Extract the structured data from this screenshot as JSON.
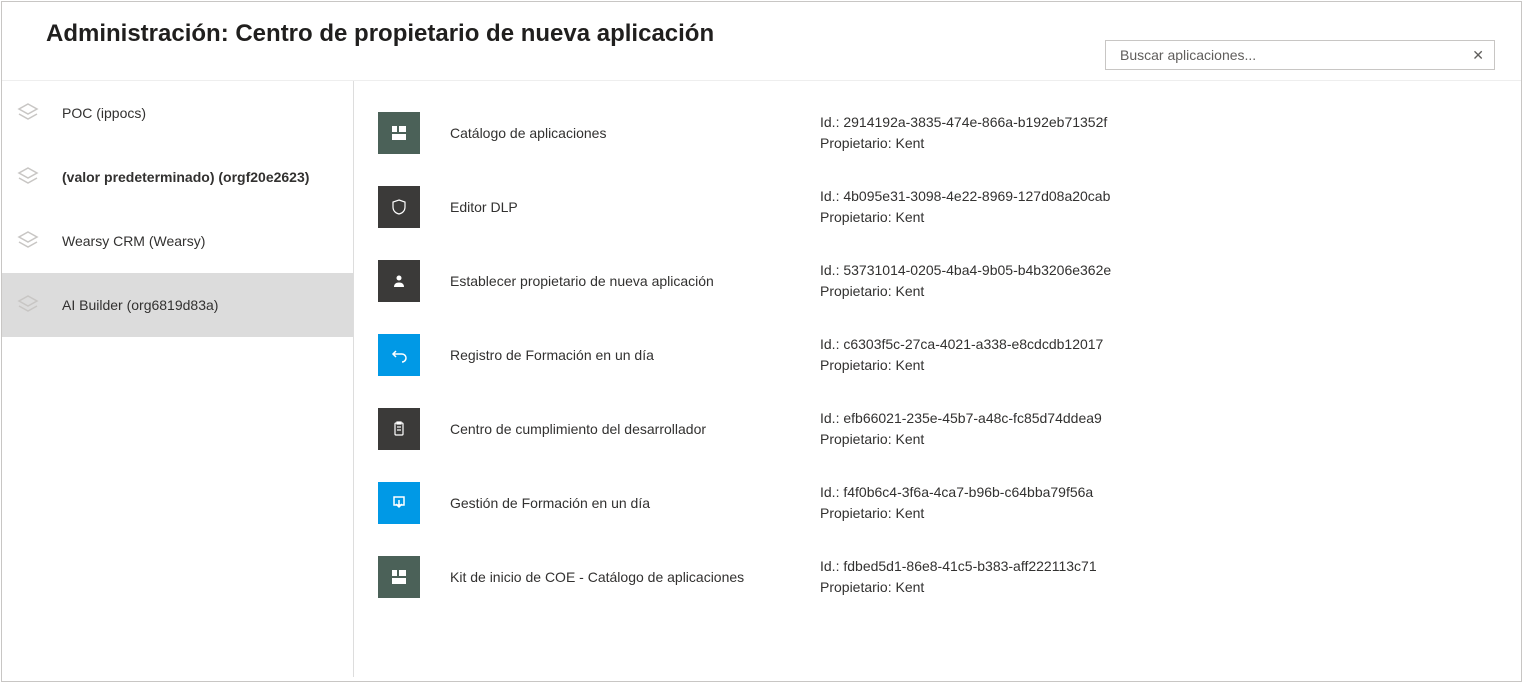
{
  "header": {
    "title": "Administración: Centro de propietario de nueva aplicación"
  },
  "search": {
    "placeholder": "Buscar aplicaciones..."
  },
  "id_label": "Id.:",
  "owner_label": "Propietario:",
  "sidebar": {
    "items": [
      {
        "label": "POC (ippocs)"
      },
      {
        "label": "(valor predeterminado) (orgf20e2623)"
      },
      {
        "label": "Wearsy CRM (Wearsy)"
      },
      {
        "label": "AI Builder (org6819d83a)"
      }
    ]
  },
  "apps": [
    {
      "name": "Catálogo de aplicaciones",
      "id": "2914192a-3835-474e-866a-b192eb71352f",
      "owner": "Kent"
    },
    {
      "name": "Editor DLP",
      "id": "4b095e31-3098-4e22-8969-127d08a20cab",
      "owner": "Kent"
    },
    {
      "name": "Establecer propietario de nueva aplicación",
      "id": "53731014-0205-4ba4-9b05-b4b3206e362e",
      "owner": "Kent"
    },
    {
      "name": "Registro de Formación en un día",
      "id": "c6303f5c-27ca-4021-a338-e8cdcdb12017",
      "owner": "Kent"
    },
    {
      "name": "Centro de cumplimiento del desarrollador",
      "id": "efb66021-235e-45b7-a48c-fc85d74ddea9",
      "owner": "Kent"
    },
    {
      "name": "Gestión de Formación en un día",
      "id": "f4f0b6c4-3f6a-4ca7-b96b-c64bba79f56a",
      "owner": "Kent"
    },
    {
      "name": "Kit de inicio de COE - Catálogo de aplicaciones",
      "id": "fdbed5d1-86e8-41c5-b383-aff222113c71",
      "owner": "Kent"
    }
  ]
}
